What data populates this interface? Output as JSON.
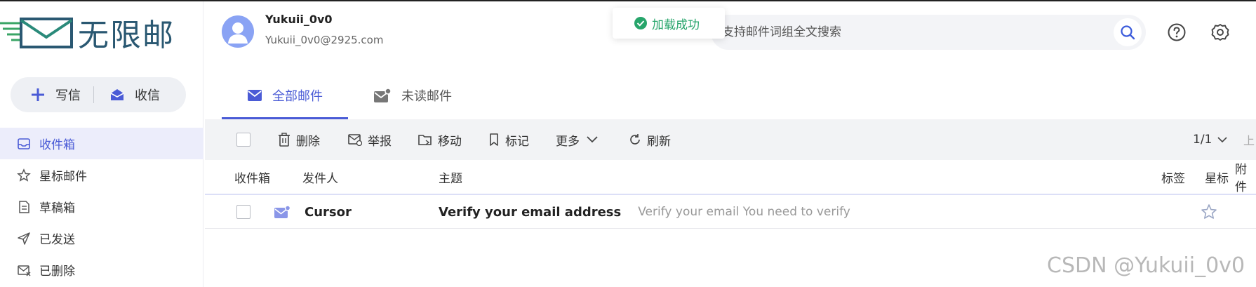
{
  "brand": {
    "name": "无限邮",
    "logo_color": "#2a5872",
    "logo_accent": "#3aa566"
  },
  "compose": {
    "write_label": "写信",
    "receive_label": "收信"
  },
  "nav": [
    {
      "label": "收件箱",
      "icon": "inbox-icon",
      "active": true
    },
    {
      "label": "星标邮件",
      "icon": "star-icon",
      "active": false
    },
    {
      "label": "草稿箱",
      "icon": "draft-icon",
      "active": false
    },
    {
      "label": "已发送",
      "icon": "send-icon",
      "active": false
    },
    {
      "label": "已删除",
      "icon": "trash-mail-icon",
      "active": false
    }
  ],
  "user": {
    "name": "Yukuii_0v0",
    "email": "Yukuii_0v0@2925.com"
  },
  "toast": {
    "text": "加载成功",
    "color": "#27a56b"
  },
  "search": {
    "placeholder": "支持邮件词组全文搜索"
  },
  "tabs": [
    {
      "label": "全部邮件",
      "icon": "mail-icon",
      "active": true
    },
    {
      "label": "未读邮件",
      "icon": "unread-mail-icon",
      "active": false
    }
  ],
  "toolbar": {
    "delete_label": "删除",
    "report_label": "举报",
    "move_label": "移动",
    "mark_label": "标记",
    "more_label": "更多",
    "refresh_label": "刷新",
    "page_indicator": "1/1",
    "next_label": "上"
  },
  "table": {
    "headers": {
      "folder": "收件箱",
      "sender": "发件人",
      "subject": "主题",
      "tag": "标签",
      "star": "星标",
      "attach": "附件"
    },
    "rows": [
      {
        "sender": "Cursor",
        "subject": "Verify your email address",
        "preview": "Verify your email You need to verify",
        "starred": false
      }
    ]
  },
  "watermark": "CSDN @Yukuii_0v0",
  "colors": {
    "accent": "#4a5bd6",
    "active_bg": "#ecedfb"
  }
}
